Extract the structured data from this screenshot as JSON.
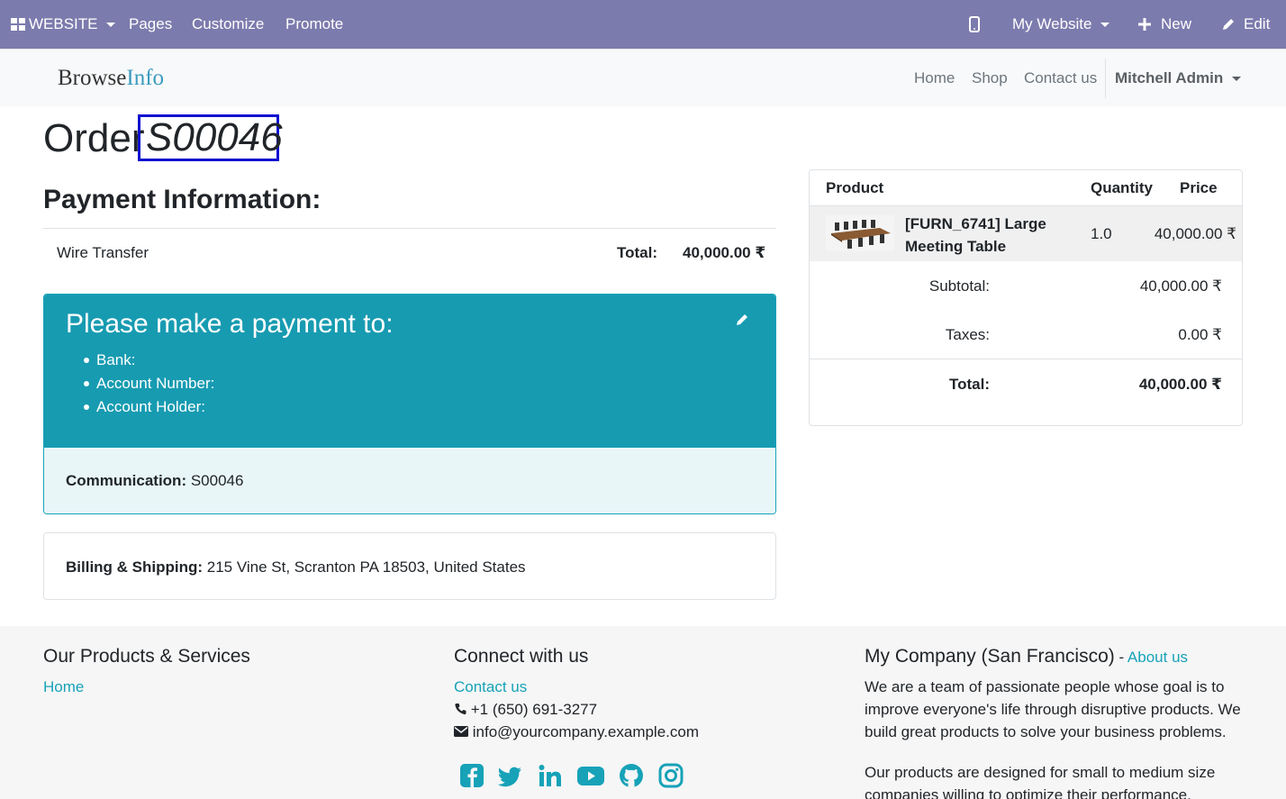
{
  "admin_bar": {
    "website_label": "WEBSITE",
    "pages": "Pages",
    "customize": "Customize",
    "promote": "Promote",
    "my_website": "My Website",
    "new": "New",
    "edit": "Edit"
  },
  "header": {
    "logo_part1": "Browse",
    "logo_part2": "Info",
    "nav": [
      "Home",
      "Shop",
      "Contact us"
    ],
    "user": "Mitchell Admin"
  },
  "order": {
    "title": "Order",
    "number": "S00046"
  },
  "payment": {
    "heading": "Payment Information:",
    "method": "Wire Transfer",
    "total_label": "Total:",
    "total_value": "40,000.00 ₹",
    "instructions_title": "Please make a payment to:",
    "fields": [
      "Bank:",
      "Account Number:",
      "Account Holder:"
    ],
    "communication_label": "Communication:",
    "communication_value": " S00046"
  },
  "billing": {
    "label": "Billing & Shipping:",
    "address": " 215 Vine St, Scranton PA 18503, United States"
  },
  "summary": {
    "headers": {
      "product": "Product",
      "quantity": "Quantity",
      "price": "Price"
    },
    "product_name": "[FURN_6741] Large Meeting Table",
    "quantity": "1.0",
    "price": "40,000.00 ₹",
    "subtotal_label": "Subtotal:",
    "subtotal_value": "40,000.00 ₹",
    "taxes_label": "Taxes:",
    "taxes_value": "0.00 ₹",
    "total_label": "Total:",
    "total_value": "40,000.00 ₹"
  },
  "footer": {
    "col1_title": "Our Products & Services",
    "col1_link": "Home",
    "col2_title": "Connect with us",
    "col2_contact": "Contact us",
    "phone": "+1 (650) 691-3277",
    "email": "info@yourcompany.example.com",
    "col3_title": "My Company (San Francisco)",
    "col3_sep": " - ",
    "col3_link": "About us",
    "about_p1": "We are a team of passionate people whose goal is to improve everyone's life through disruptive products. We build great products to solve your business problems.",
    "about_p2": "Our products are designed for small to medium size companies willing to optimize their performance.",
    "social_icons": [
      "facebook-icon",
      "twitter-icon",
      "linkedin-icon",
      "youtube-icon",
      "github-icon",
      "instagram-icon"
    ]
  },
  "colors": {
    "admin_bar": "#7c7bad",
    "accent": "#17a2b8",
    "payment_box": "#179bb1",
    "highlight_border": "#1010d0"
  }
}
